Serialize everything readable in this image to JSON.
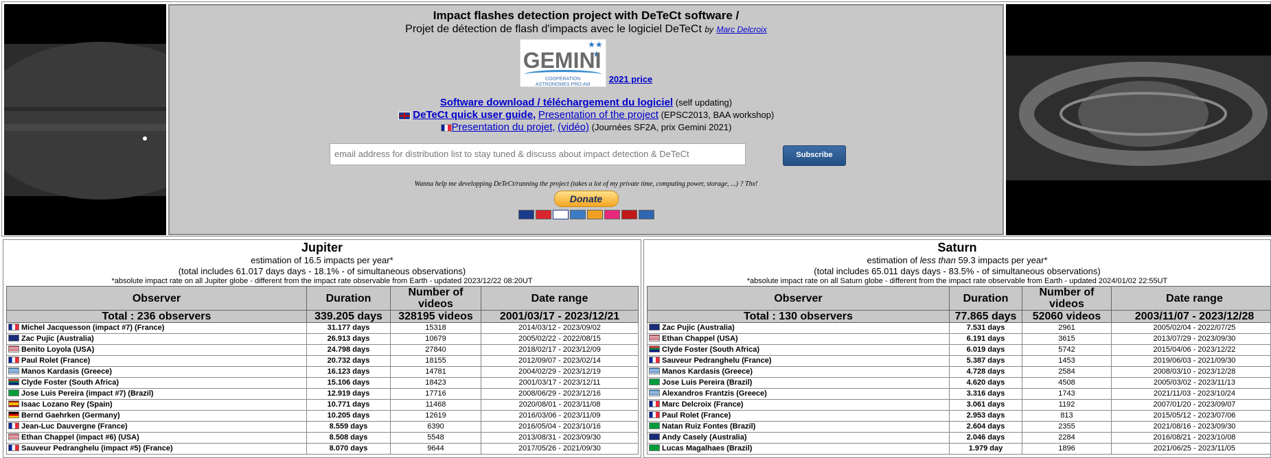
{
  "header": {
    "title": "Impact flashes detection project with DeTeCt software /",
    "subtitle": "Projet de détection de flash d'impacts avec le logiciel DeTeCt",
    "by": "by",
    "author": "Marc Delcroix",
    "logo_word": "GEMINI",
    "logo_sub1": "COOPÉRATION",
    "logo_sub2": "ASTRONOMES PRO-AM",
    "price_link": "2021 price",
    "download_link": "Software download / téléchargement du logiciel",
    "download_note": "(self updating)",
    "guide_link": "DeTeCt quick user guide,",
    "presentation_link": "Presentation of the project",
    "presentation_note": "(EPSC2013, BAA workshop)",
    "projet_link": "Presentation du projet,",
    "video_link": "(vidéo)",
    "projet_note": "(Journées SF2A, prix Gemini 2021)",
    "email_placeholder": "email address for distribution list to stay tuned & discuss about impact detection & DeTeCt",
    "subscribe_label": "Subscribe",
    "wanna_text": "Wanna help me developping DeTeCt/running the project (takes a lot of my private time, computing power, storage, ...) ? Thx!",
    "donate_label": "Donate"
  },
  "columns": {
    "observer": "Observer",
    "duration": "Duration",
    "videos": "Number of videos",
    "dates": "Date range"
  },
  "jupiter": {
    "title": "Jupiter",
    "line1": "estimation of 16.5 impacts per year*",
    "line2": "(total includes 61.017 days days - 18.1% - of simultaneous observations)",
    "note": "*absolute impact rate on all Jupiter globe - different from the impact rate observable from Earth - updated 2023/12/22 08:20UT",
    "total": {
      "observer": "Total : 236 observers",
      "duration": "339.205 days",
      "videos": "328195 videos",
      "dates": "2001/03/17 - 2023/12/21"
    },
    "rows": [
      {
        "flag": "fr",
        "observer": "Michel Jacquesson (impact #7) (France)",
        "duration": "31.177 days",
        "videos": "15318",
        "dates": "2014/03/12 - 2023/09/02"
      },
      {
        "flag": "au",
        "observer": "Zac Pujic (Australia)",
        "duration": "26.913 days",
        "videos": "10679",
        "dates": "2005/02/22 - 2022/08/15"
      },
      {
        "flag": "us",
        "observer": "Benito Loyola (USA)",
        "duration": "24.798 days",
        "videos": "27840",
        "dates": "2018/02/17 - 2023/12/09"
      },
      {
        "flag": "fr",
        "observer": "Paul Rolet (France)",
        "duration": "20.732 days",
        "videos": "18155",
        "dates": "2012/09/07 - 2023/02/14"
      },
      {
        "flag": "gr",
        "observer": "Manos Kardasis (Greece)",
        "duration": "16.123 days",
        "videos": "14781",
        "dates": "2004/02/29 - 2023/12/19"
      },
      {
        "flag": "za",
        "observer": "Clyde Foster (South Africa)",
        "duration": "15.106 days",
        "videos": "18423",
        "dates": "2001/03/17 - 2023/12/11"
      },
      {
        "flag": "br",
        "observer": "Jose Luis Pereira (impact #7) (Brazil)",
        "duration": "12.919 days",
        "videos": "17716",
        "dates": "2008/06/29 - 2023/12/16"
      },
      {
        "flag": "es",
        "observer": "Isaac Lozano Rey (Spain)",
        "duration": "10.771 days",
        "videos": "11468",
        "dates": "2020/08/01 - 2023/11/08"
      },
      {
        "flag": "de",
        "observer": "Bernd Gaehrken (Germany)",
        "duration": "10.205 days",
        "videos": "12619",
        "dates": "2016/03/06 - 2023/11/09"
      },
      {
        "flag": "fr",
        "observer": "Jean-Luc Dauvergne (France)",
        "duration": "8.559 days",
        "videos": "6390",
        "dates": "2016/05/04 - 2023/10/16"
      },
      {
        "flag": "us",
        "observer": "Ethan Chappel (impact #6) (USA)",
        "duration": "8.508 days",
        "videos": "5548",
        "dates": "2013/08/31 - 2023/09/30"
      },
      {
        "flag": "fr",
        "observer": "Sauveur Pedranghelu (impact #5) (France)",
        "duration": "8.070 days",
        "videos": "9644",
        "dates": "2017/05/26 - 2021/09/30"
      }
    ]
  },
  "saturn": {
    "title": "Saturn",
    "line1a": "estimation of ",
    "line1b": "less than",
    "line1c": " 59.3 impacts per year*",
    "line2": "(total includes 65.011 days days - 83.5% - of simultaneous observations)",
    "note": "*absolute impact rate on all Saturn globe - different from the impact rate observable from Earth - updated 2024/01/02 22:55UT",
    "total": {
      "observer": "Total : 130 observers",
      "duration": "77.865 days",
      "videos": "52060 videos",
      "dates": "2003/11/07 - 2023/12/28"
    },
    "rows": [
      {
        "flag": "au",
        "observer": "Zac Pujic (Australia)",
        "duration": "7.531 days",
        "videos": "2961",
        "dates": "2005/02/04 - 2022/07/25"
      },
      {
        "flag": "us",
        "observer": "Ethan Chappel (USA)",
        "duration": "6.191 days",
        "videos": "3615",
        "dates": "2013/07/29 - 2023/09/30"
      },
      {
        "flag": "za",
        "observer": "Clyde Foster (South Africa)",
        "duration": "6.019 days",
        "videos": "5742",
        "dates": "2015/04/06 - 2023/12/22"
      },
      {
        "flag": "fr",
        "observer": "Sauveur Pedranghelu (France)",
        "duration": "5.387 days",
        "videos": "1453",
        "dates": "2019/06/03 - 2021/09/30"
      },
      {
        "flag": "gr",
        "observer": "Manos Kardasis (Greece)",
        "duration": "4.728 days",
        "videos": "2584",
        "dates": "2008/03/10 - 2023/12/28"
      },
      {
        "flag": "br",
        "observer": "Jose Luis Pereira (Brazil)",
        "duration": "4.620 days",
        "videos": "4508",
        "dates": "2005/03/02 - 2023/11/13"
      },
      {
        "flag": "gr",
        "observer": "Alexandros Frantzis (Greece)",
        "duration": "3.316 days",
        "videos": "1743",
        "dates": "2021/11/03 - 2023/10/24"
      },
      {
        "flag": "fr",
        "observer": "Marc Delcroix (France)",
        "duration": "3.061 days",
        "videos": "1192",
        "dates": "2007/01/20 - 2023/09/07"
      },
      {
        "flag": "fr",
        "observer": "Paul Rolet (France)",
        "duration": "2.953 days",
        "videos": "813",
        "dates": "2015/05/12 - 2023/07/06"
      },
      {
        "flag": "br",
        "observer": "Natan Ruiz Fontes (Brazil)",
        "duration": "2.604 days",
        "videos": "2355",
        "dates": "2021/08/16 - 2023/09/30"
      },
      {
        "flag": "au",
        "observer": "Andy Casely (Australia)",
        "duration": "2.046 days",
        "videos": "2284",
        "dates": "2016/08/21 - 2023/10/08"
      },
      {
        "flag": "br",
        "observer": "Lucas Magalhaes (Brazil)",
        "duration": "1.979 day",
        "videos": "1896",
        "dates": "2021/06/25 - 2023/11/05"
      }
    ]
  }
}
